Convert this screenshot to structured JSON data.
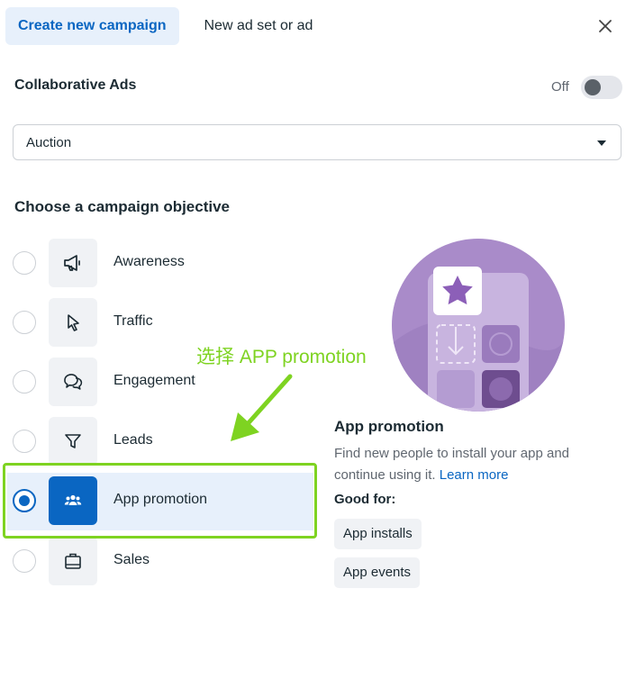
{
  "tabs": {
    "create_new_campaign": "Create new campaign",
    "new_ad_set_or_ad": "New ad set or ad"
  },
  "collaborative_ads": {
    "label": "Collaborative Ads",
    "toggle_state": "Off"
  },
  "buying_type": {
    "selected": "Auction"
  },
  "objective_heading": "Choose a campaign objective",
  "objectives": [
    {
      "label": "Awareness",
      "icon": "megaphone-icon",
      "selected": false
    },
    {
      "label": "Traffic",
      "icon": "cursor-icon",
      "selected": false
    },
    {
      "label": "Engagement",
      "icon": "chat-bubbles-icon",
      "selected": false
    },
    {
      "label": "Leads",
      "icon": "filter-icon",
      "selected": false
    },
    {
      "label": "App promotion",
      "icon": "people-icon",
      "selected": true
    },
    {
      "label": "Sales",
      "icon": "shopping-bag-icon",
      "selected": false
    }
  ],
  "annotation": "选择 APP promotion",
  "detail": {
    "title": "App promotion",
    "description": "Find new people to install your app and continue using it.",
    "learn_more": "Learn more",
    "good_for_label": "Good for:",
    "chips": [
      "App installs",
      "App events"
    ]
  },
  "colors": {
    "accent": "#0a66c2",
    "selected_bg": "#e7f0fb",
    "annotation_green": "#7ed321",
    "illustration_purple": "#a98bc9"
  }
}
